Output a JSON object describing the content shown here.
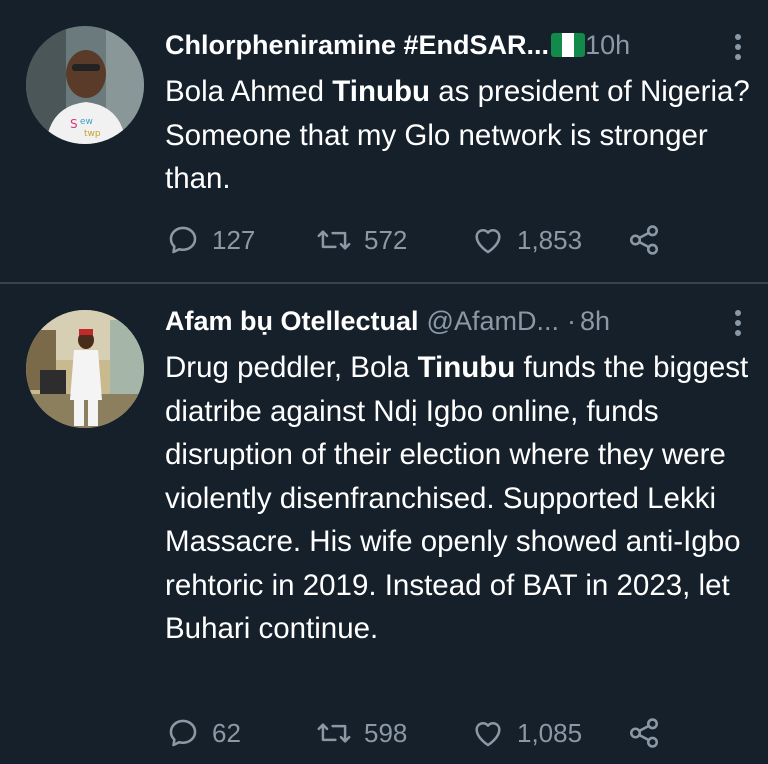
{
  "colors": {
    "background": "#15202b",
    "divider": "#38444d",
    "text_primary": "#ffffff",
    "text_secondary": "#8b98a5"
  },
  "tweets": [
    {
      "display_name": "Chlorpheniramine #EndSAR...",
      "handle": "",
      "has_flag": true,
      "time": "10h",
      "text_before": "Bola Ahmed ",
      "text_bold": "Tinubu",
      "text_after": " as president of Nigeria? Someone that my Glo network is stronger than.",
      "replies": "127",
      "retweets": "572",
      "likes": "1,853",
      "icons": {
        "reply": "reply-icon",
        "retweet": "retweet-icon",
        "like": "heart-icon",
        "share": "share-icon",
        "more": "more-vertical-icon"
      }
    },
    {
      "display_name": "Afam bụ Otellectual",
      "handle": "@AfamD...",
      "has_flag": false,
      "time": "8h",
      "text_before": "Drug peddler, Bola ",
      "text_bold": "Tinubu",
      "text_after": " funds the biggest diatribe against Ndị Igbo online, funds disruption of their election where they were violently disenfranchised. Supported Lekki Massacre. His wife openly showed anti-Igbo rehtoric in 2019. Instead of BAT in 2023, let Buhari continue.",
      "replies": "62",
      "retweets": "598",
      "likes": "1,085",
      "icons": {
        "reply": "reply-icon",
        "retweet": "retweet-icon",
        "like": "heart-icon",
        "share": "share-icon",
        "more": "more-vertical-icon"
      }
    }
  ]
}
